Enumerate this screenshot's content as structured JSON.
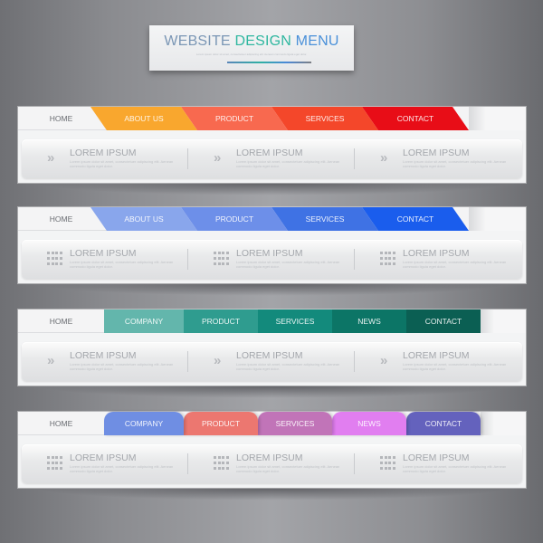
{
  "header": {
    "title_parts": [
      "WEBSITE",
      "DESIGN",
      "MENU"
    ],
    "subtitle": "Lorem ipsum dolor sit amet, consectetuer adipiscing elit. Aenean commodo ligula eget dolor."
  },
  "menus": [
    {
      "style": "slanted",
      "home_label": "HOME",
      "tabs": [
        {
          "label": "ABOUT US",
          "color": "#f9a72e"
        },
        {
          "label": "PRODUCT",
          "color": "#f8694f"
        },
        {
          "label": "SERVICES",
          "color": "#f4472a"
        },
        {
          "label": "CONTACT",
          "color": "#e80d17"
        }
      ],
      "icon": "double-chevron-right-icon",
      "items": [
        {
          "heading": "LOREM IPSUM",
          "text": "Lorem ipsum dolor sit amet, consectetuer adipiscing elit. Aenean commodo ligula eget dolor."
        },
        {
          "heading": "LOREM IPSUM",
          "text": "Lorem ipsum dolor sit amet, consectetuer adipiscing elit. Aenean commodo ligula eget dolor."
        },
        {
          "heading": "LOREM IPSUM",
          "text": "Lorem ipsum dolor sit amet, consectetuer adipiscing elit. Aenean commodo ligula eget dolor."
        }
      ]
    },
    {
      "style": "slanted",
      "home_label": "HOME",
      "tabs": [
        {
          "label": "ABOUT US",
          "color": "#89a6ec"
        },
        {
          "label": "PRODUCT",
          "color": "#6d8fe9"
        },
        {
          "label": "SERVICES",
          "color": "#3f72e4"
        },
        {
          "label": "CONTACT",
          "color": "#1a5ded"
        }
      ],
      "icon": "grid-icon",
      "items": [
        {
          "heading": "LOREM IPSUM",
          "text": "Lorem ipsum dolor sit amet, consectetuer adipiscing elit. Aenean commodo ligula eget dolor."
        },
        {
          "heading": "LOREM IPSUM",
          "text": "Lorem ipsum dolor sit amet, consectetuer adipiscing elit. Aenean commodo ligula eget dolor."
        },
        {
          "heading": "LOREM IPSUM",
          "text": "Lorem ipsum dolor sit amet, consectetuer adipiscing elit. Aenean commodo ligula eget dolor."
        }
      ]
    },
    {
      "style": "flat",
      "home_label": "HOME",
      "tabs": [
        {
          "label": "COMPANY",
          "color": "#63b6ac"
        },
        {
          "label": "PRODUCT",
          "color": "#2f9c8f"
        },
        {
          "label": "SERVICES",
          "color": "#138a7c"
        },
        {
          "label": "NEWS",
          "color": "#0c7566"
        },
        {
          "label": "CONTACT",
          "color": "#0b5f53"
        }
      ],
      "icon": "double-chevron-right-icon",
      "items": [
        {
          "heading": "LOREM IPSUM",
          "text": "Lorem ipsum dolor sit amet, consectetuer adipiscing elit. Aenean commodo ligula eget dolor."
        },
        {
          "heading": "LOREM IPSUM",
          "text": "Lorem ipsum dolor sit amet, consectetuer adipiscing elit. Aenean commodo ligula eget dolor."
        },
        {
          "heading": "LOREM IPSUM",
          "text": "Lorem ipsum dolor sit amet, consectetuer adipiscing elit. Aenean commodo ligula eget dolor."
        }
      ]
    },
    {
      "style": "rounded",
      "home_label": "HOME",
      "tabs": [
        {
          "label": "COMPANY",
          "color": "#6f8ee3"
        },
        {
          "label": "PRODUCT",
          "color": "#ec7770"
        },
        {
          "label": "SERVICES",
          "color": "#c174b8"
        },
        {
          "label": "NEWS",
          "color": "#e17ef0"
        },
        {
          "label": "CONTACT",
          "color": "#6462bd"
        }
      ],
      "icon": "grid-icon",
      "items": [
        {
          "heading": "LOREM IPSUM",
          "text": "Lorem ipsum dolor sit amet, consectetuer adipiscing elit. Aenean commodo ligula eget dolor."
        },
        {
          "heading": "LOREM IPSUM",
          "text": "Lorem ipsum dolor sit amet, consectetuer adipiscing elit. Aenean commodo ligula eget dolor."
        },
        {
          "heading": "LOREM IPSUM",
          "text": "Lorem ipsum dolor sit amet, consectetuer adipiscing elit. Aenean commodo ligula eget dolor."
        }
      ]
    }
  ]
}
